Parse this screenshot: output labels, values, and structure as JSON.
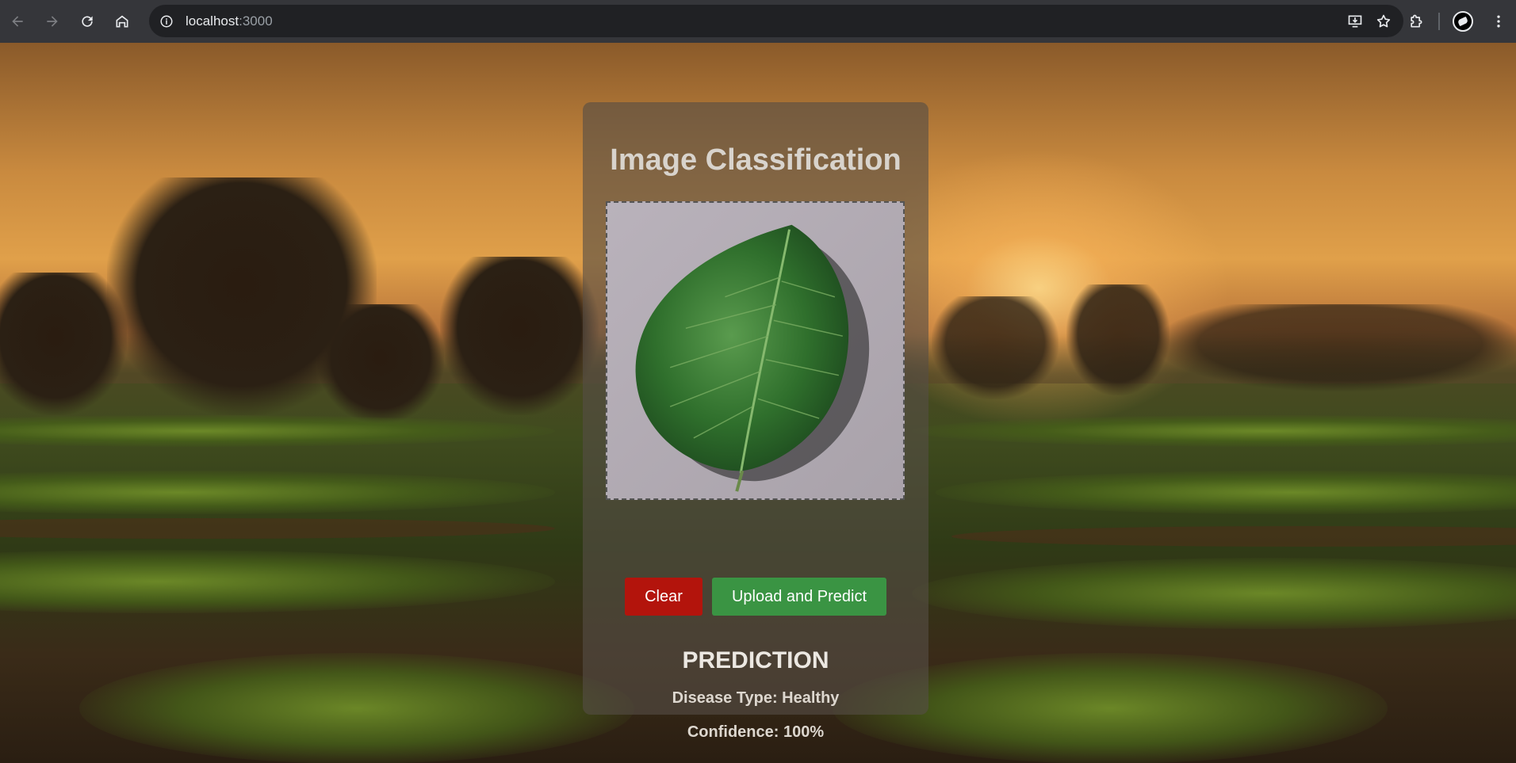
{
  "browser": {
    "url_host": "localhost",
    "url_port": ":3000",
    "icons": {
      "back": "arrow-left-icon",
      "forward": "arrow-right-icon",
      "reload": "reload-icon",
      "home": "home-icon",
      "site_info": "info-icon",
      "install": "install-app-icon",
      "bookmark": "star-icon",
      "extensions": "puzzle-icon",
      "profile": "avatar",
      "menu": "kebab-menu-icon"
    }
  },
  "app": {
    "title": "Image Classification",
    "buttons": {
      "clear_label": "Clear",
      "upload_label": "Upload and Predict"
    },
    "prediction": {
      "heading": "PREDICTION",
      "disease_text": "Disease Type: Healthy",
      "confidence_text": "Confidence: 100%"
    },
    "colors": {
      "clear_button": "#b3140c",
      "upload_button": "#3a9443"
    }
  }
}
